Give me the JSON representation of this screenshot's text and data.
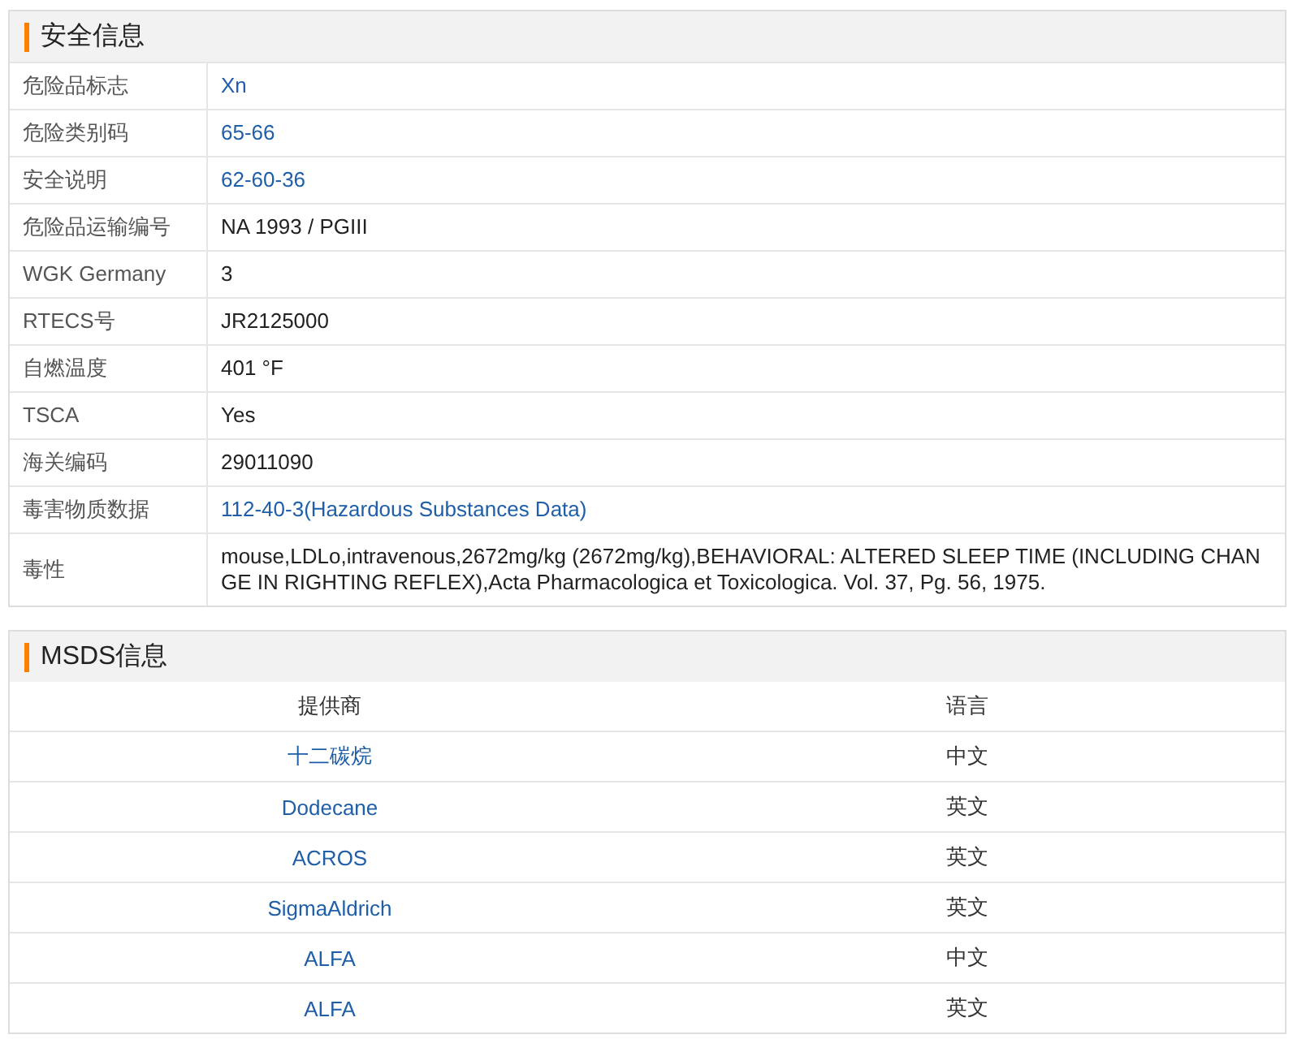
{
  "safety": {
    "title": "安全信息",
    "rows": [
      {
        "label": "危险品标志",
        "value": "Xn",
        "kind": "link"
      },
      {
        "label": "危险类别码",
        "value": "65-66",
        "kind": "link"
      },
      {
        "label": "安全说明",
        "value": "62-60-36",
        "kind": "link"
      },
      {
        "label": "危险品运输编号",
        "value": "NA 1993 / PGIII",
        "kind": "text"
      },
      {
        "label": "WGK Germany",
        "value": "3",
        "kind": "text"
      },
      {
        "label": "RTECS号",
        "value": "JR2125000",
        "kind": "text"
      },
      {
        "label": "自燃温度",
        "value": "401 °F",
        "kind": "text"
      },
      {
        "label": "TSCA",
        "value": "Yes",
        "kind": "text"
      },
      {
        "label": "海关编码",
        "value": "29011090",
        "kind": "text"
      },
      {
        "label": "毒害物质数据",
        "value": "112-40-3(Hazardous Substances Data)",
        "kind": "link"
      },
      {
        "label": "毒性",
        "value": "mouse,LDLo,intravenous,2672mg/kg (2672mg/kg),BEHAVIORAL: ALTERED SLEEP TIME (INCLUDING CHANGE IN RIGHTING REFLEX),Acta Pharmacologica et Toxicologica. Vol. 37, Pg. 56, 1975.",
        "kind": "text"
      }
    ]
  },
  "msds": {
    "title": "MSDS信息",
    "columns": [
      "提供商",
      "语言"
    ],
    "rows": [
      {
        "provider": "十二碳烷",
        "language": "中文"
      },
      {
        "provider": "Dodecane",
        "language": "英文"
      },
      {
        "provider": "ACROS",
        "language": "英文"
      },
      {
        "provider": "SigmaAldrich",
        "language": "英文"
      },
      {
        "provider": "ALFA",
        "language": "中文"
      },
      {
        "provider": "ALFA",
        "language": "英文"
      }
    ]
  }
}
